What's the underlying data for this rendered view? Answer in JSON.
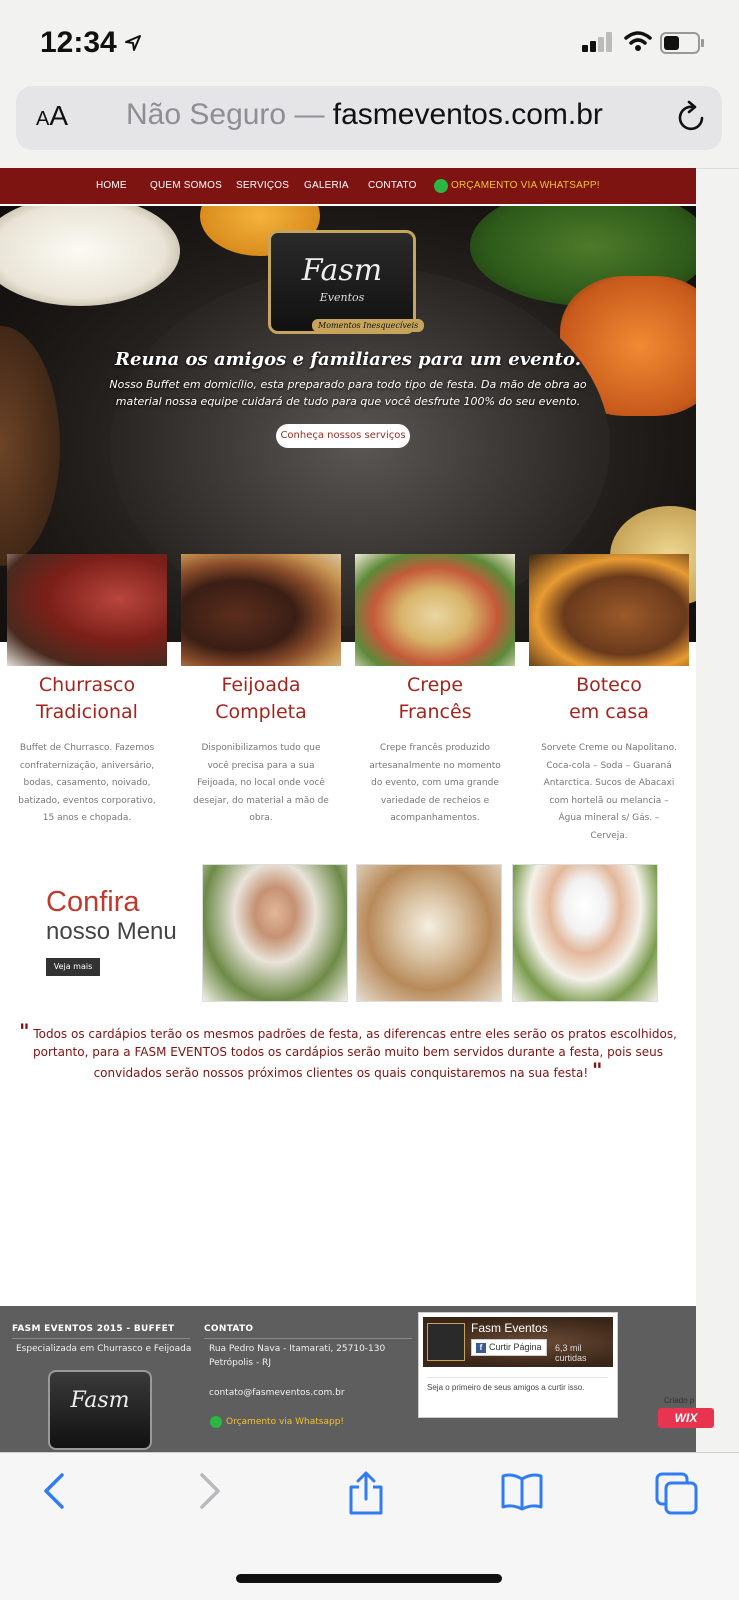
{
  "status": {
    "time": "12:34"
  },
  "browser": {
    "aa_label": "AA",
    "url_prefix": "Não Seguro — ",
    "url_domain": "fasmeventos.com.br"
  },
  "nav": {
    "items": [
      "HOME",
      "QUEM SOMOS",
      "SERVIÇOS",
      "GALERIA",
      "CONTATO"
    ],
    "whatsapp": "ORÇAMENTO VIA WHATSAPP!"
  },
  "hero": {
    "logo_name": "Fasm",
    "logo_sub": "Eventos",
    "logo_tag": "Momentos Inesquecíveis",
    "title": "Reuna os amigos e familiares para um evento.",
    "text": "Nosso Buffet em domicílio, esta preparado para todo tipo de festa. Da mão de obra ao material nossa equipe cuidará de tudo para que você desfrute 100% do seu evento.",
    "button": "Conheça nossos serviços"
  },
  "services": [
    {
      "title_1": "Churrasco",
      "title_2": "Tradicional",
      "text": "Buffet de Churrasco. Fazemos confraternização, aniversário, bodas, casamento, noivado, batizado, eventos corporativo, 15 anos e chopada."
    },
    {
      "title_1": "Feijoada",
      "title_2": "Completa",
      "text": "Disponibilizamos tudo que você precisa para a sua Feijoada, no local onde você desejar, do material a mão de obra."
    },
    {
      "title_1": "Crepe",
      "title_2": "Francês",
      "text": "Crepe francês produzido artesanalmente no momento do evento, com uma grande variedade de recheios e acompanhamentos."
    },
    {
      "title_1": "Boteco",
      "title_2": "em casa",
      "text": "Sorvete Creme ou Napolitano. Coca-cola – Soda – Guaraná Antarctica. Sucos de Abacaxi com hortelã ou melancia –Água mineral s/ Gás. – Cerveja."
    }
  ],
  "promo": {
    "confira": "Confira",
    "nosso_menu": "nosso Menu",
    "veja_mais": "Veja mais",
    "quote": "Todos os cardápios terão os mesmos padrões de festa, as diferencas entre eles serão os pratos escolhidos, portanto, para a FASM EVENTOS todos os cardápios serão muito bem servidos durante a festa, pois seus convidados serão nossos próximos clientes os quais conquistaremos na sua festa!"
  },
  "footer": {
    "brand_heading": "FASM EVENTOS 2015 - BUFFET",
    "brand_sub": "Especializada em Churrasco e Feijoada",
    "logo_name": "Fasm",
    "contact_heading": "CONTATO",
    "address_1": "Rua Pedro Nava - Itamarati, 25710-130",
    "address_2": "Petrópolis - RJ",
    "email": "contato@fasmeventos.com.br",
    "whatsapp": "Orçamento via Whatsapp!",
    "fb_page": "Fasm Eventos",
    "fb_like": "Curtir Página",
    "fb_count": "6,3 mil curtidas",
    "fb_friends": "Seja o primeiro de seus amigos a curtir isso.",
    "criado": "Criado p",
    "wix": "WIX"
  },
  "colors": {
    "nav_bg": "#7d1412",
    "accent_red": "#a5251d",
    "whatsapp_yellow": "#f2c230",
    "footer_bg": "#5e5e5e",
    "ios_blue": "#2f7cf6"
  },
  "icons": [
    "location-arrow-icon",
    "signal-icon",
    "wifi-icon",
    "battery-icon",
    "reload-icon",
    "whatsapp-icon",
    "back-icon",
    "forward-icon",
    "share-icon",
    "bookmarks-icon",
    "tabs-icon"
  ]
}
